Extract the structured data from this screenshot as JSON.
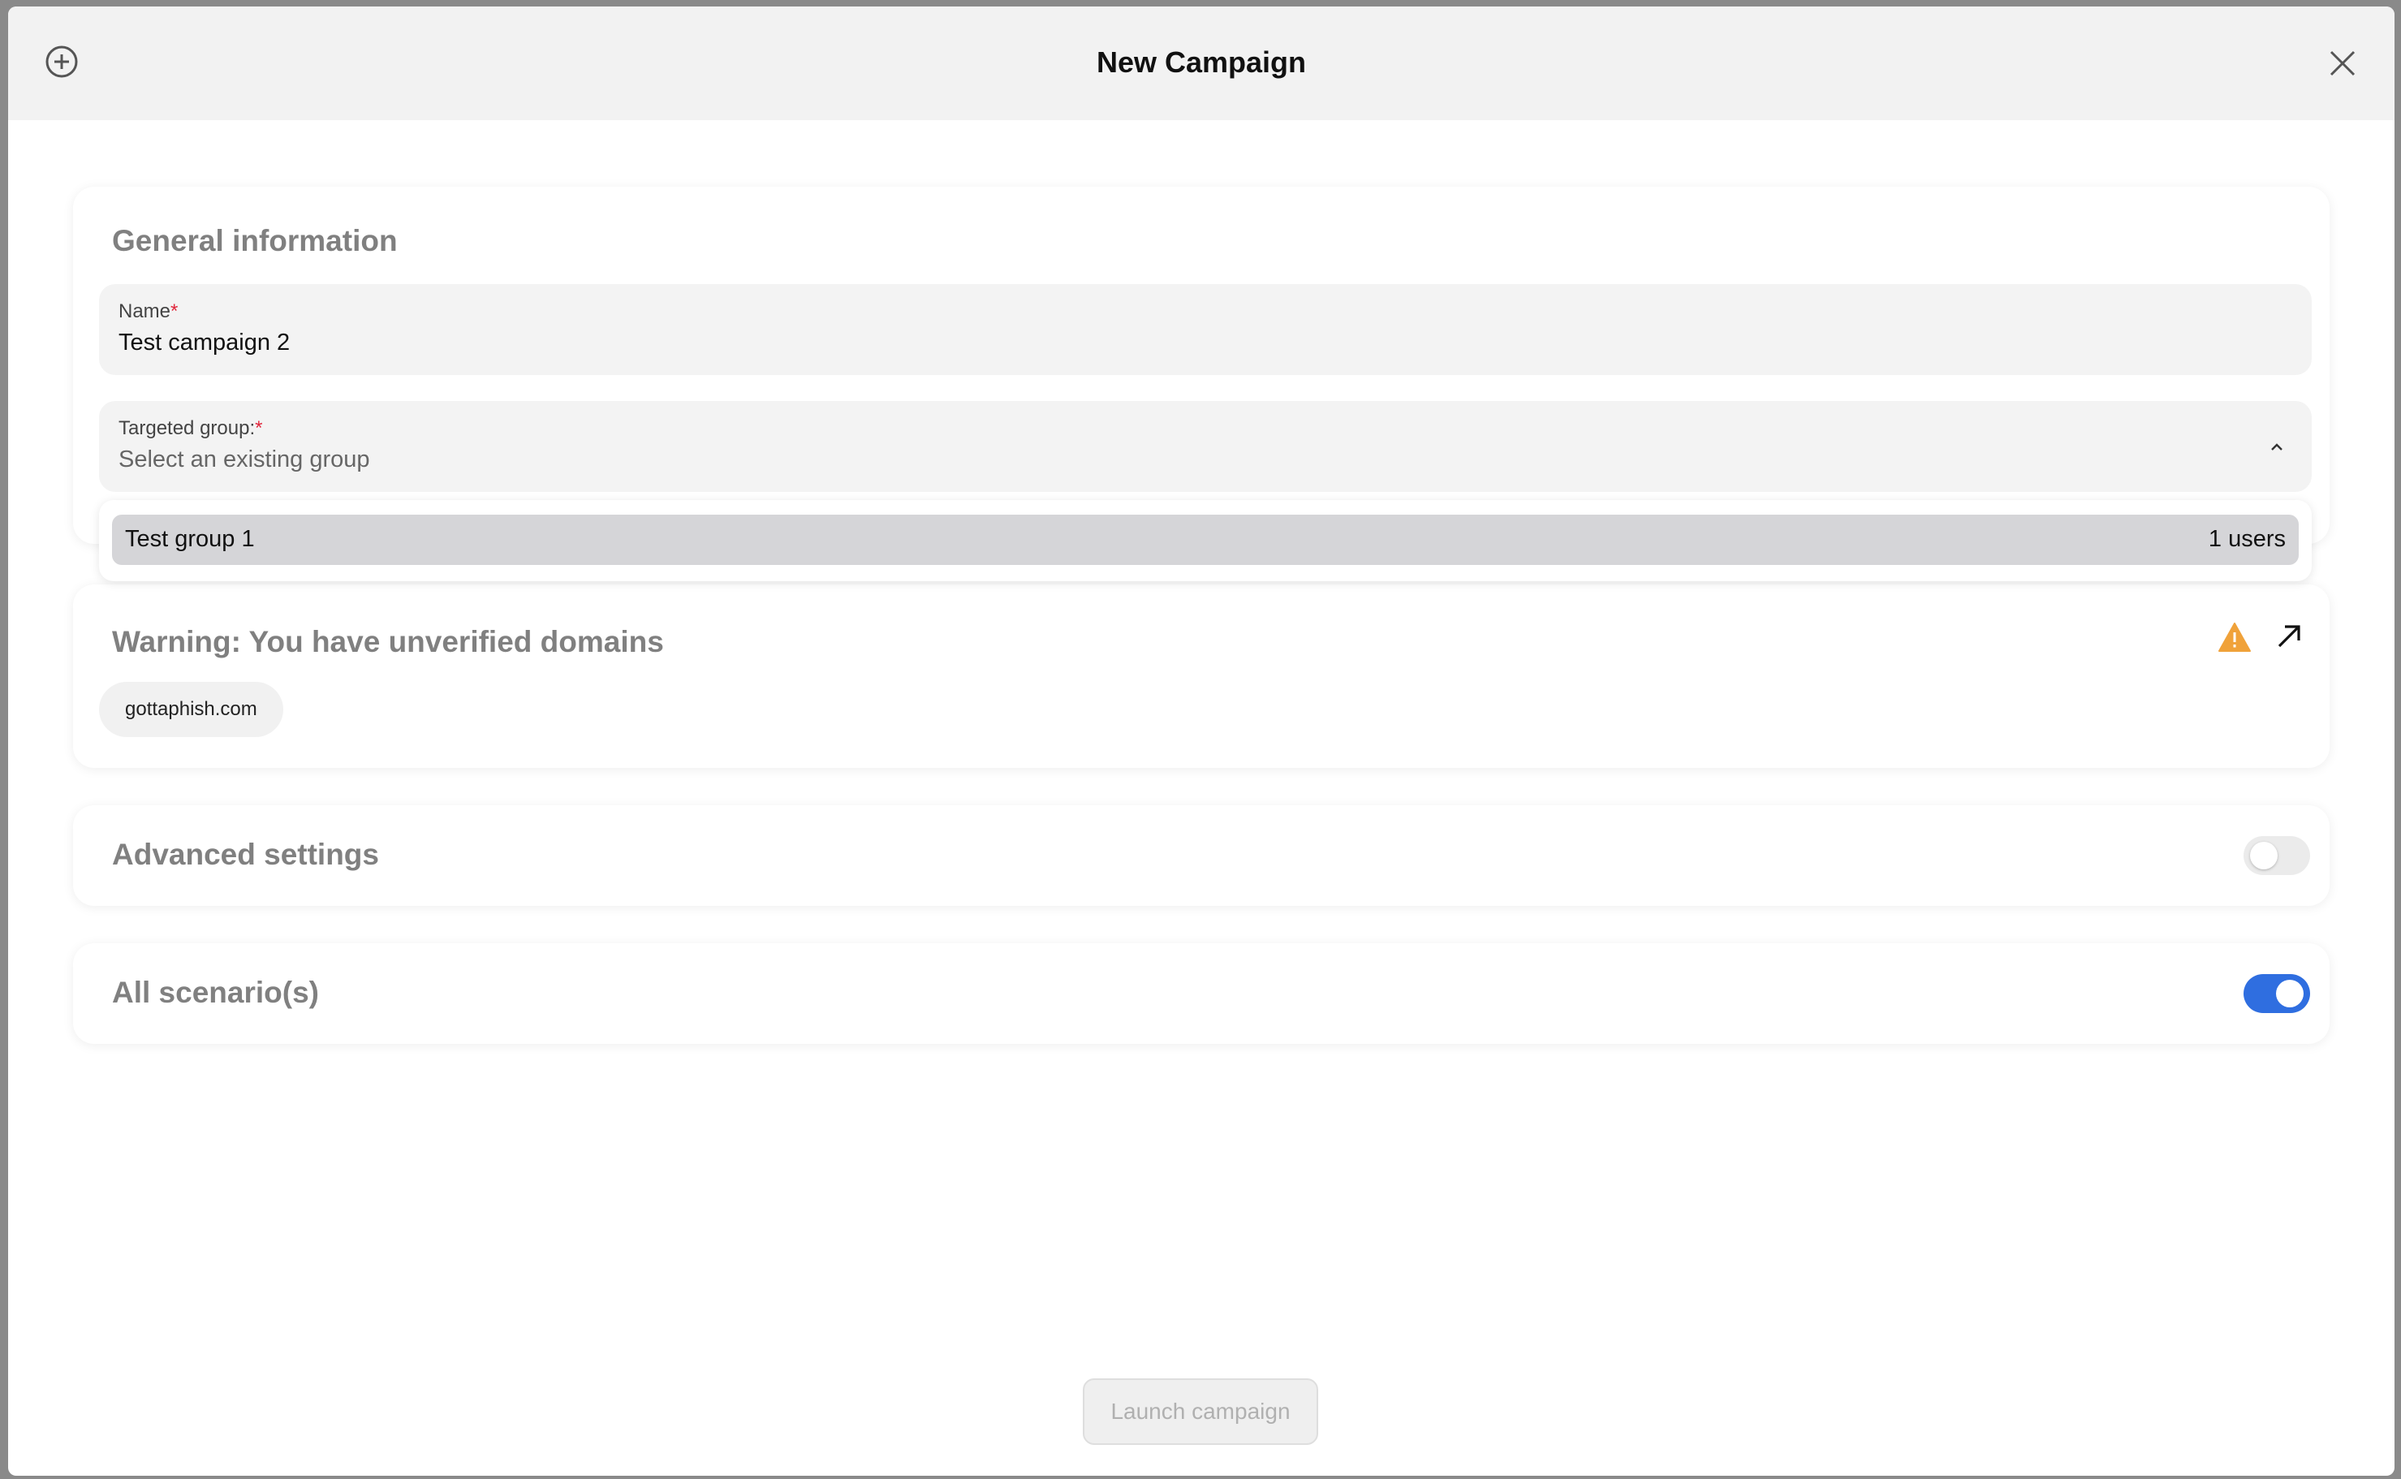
{
  "header": {
    "title": "New Campaign",
    "add_icon": "plus-circle-icon",
    "close_icon": "close-icon"
  },
  "general": {
    "title": "General information",
    "name_label": "Name",
    "required_mark": "*",
    "name_value": "Test campaign 2",
    "group_label": "Targeted group:",
    "group_placeholder": "Select an existing group",
    "chevron_icon": "chevron-up-icon"
  },
  "dropdown": {
    "options": [
      {
        "name": "Test group 1",
        "count": "1 users"
      }
    ]
  },
  "warning": {
    "title": "Warning: You have unverified domains",
    "warning_icon": "warning-triangle-icon",
    "link_icon": "external-arrow-icon",
    "domains": [
      "gottaphish.com"
    ]
  },
  "advanced": {
    "title": "Advanced settings",
    "enabled": false
  },
  "scenarios": {
    "title": "All scenario(s)",
    "enabled": true
  },
  "footer": {
    "launch_label": "Launch campaign"
  },
  "colors": {
    "accent": "#2f6ee0",
    "required": "#e0263b",
    "warning": "#f0a23a"
  }
}
